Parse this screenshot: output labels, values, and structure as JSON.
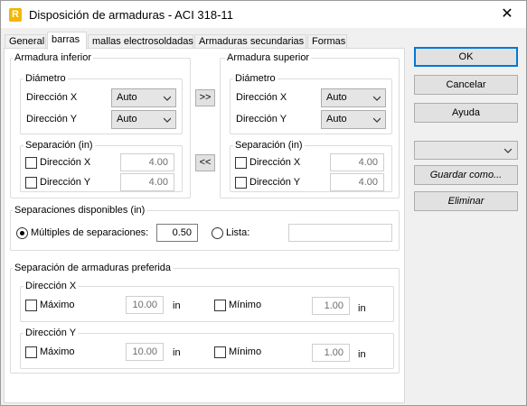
{
  "window": {
    "title": "Disposición de armaduras - ACI 318-11",
    "app_icon_letter": "R",
    "close_glyph": "✕"
  },
  "tabs": [
    {
      "label": "General",
      "active": false
    },
    {
      "label": "barras",
      "active": true
    },
    {
      "label": "mallas electrosoldadas",
      "active": false
    },
    {
      "label": "Armaduras secundarias",
      "active": false
    },
    {
      "label": "Formas",
      "active": false
    }
  ],
  "bottom_rebar": {
    "title": "Armadura inferior",
    "diameter_title": "Diámetro",
    "dir_x_label": "Dirección X",
    "dir_x_value": "Auto",
    "dir_y_label": "Dirección Y",
    "dir_y_value": "Auto",
    "spacing_title": "Separación (in)",
    "spacing_x_label": "Dirección X",
    "spacing_x_value": "4.00",
    "spacing_y_label": "Dirección Y",
    "spacing_y_value": "4.00"
  },
  "top_rebar": {
    "title": "Armadura superior",
    "diameter_title": "Diámetro",
    "dir_x_label": "Dirección X",
    "dir_x_value": "Auto",
    "dir_y_label": "Dirección Y",
    "dir_y_value": "Auto",
    "spacing_title": "Separación (in)",
    "spacing_x_label": "Dirección X",
    "spacing_x_value": "4.00",
    "spacing_y_label": "Dirección Y",
    "spacing_y_value": "4.00"
  },
  "copy_buttons": {
    "to_top": ">>",
    "to_bottom": "<<"
  },
  "available_spacings": {
    "title": "Separaciones disponibles (in)",
    "multiples_label": "Múltiples de separaciones:",
    "multiples_value": "0.50",
    "list_label": "Lista:",
    "list_value": "",
    "selected": "multiples"
  },
  "preferred_spacing": {
    "title": "Separación de armaduras preferida",
    "dir_x": {
      "title": "Dirección X",
      "max_label": "Máximo",
      "max_value": "10.00",
      "max_unit": "in",
      "min_label": "Mínimo",
      "min_value": "1.00",
      "min_unit": "in"
    },
    "dir_y": {
      "title": "Dirección Y",
      "max_label": "Máximo",
      "max_value": "10.00",
      "max_unit": "in",
      "min_label": "Mínimo",
      "min_value": "1.00",
      "min_unit": "in"
    }
  },
  "side_buttons": {
    "ok": "OK",
    "cancel": "Cancelar",
    "help": "Ayuda",
    "preset_value": "",
    "save_as": "Guardar como...",
    "delete": "Eliminar"
  },
  "icons": {
    "combo_arrow": "chevron-down-icon",
    "close": "close-icon",
    "app": "app-logo-icon"
  },
  "colors": {
    "app_icon": "#f2b705",
    "default_button_border": "#0078d7",
    "dialog_bg": "#f0f0f0",
    "panel_bg": "#ffffff"
  }
}
